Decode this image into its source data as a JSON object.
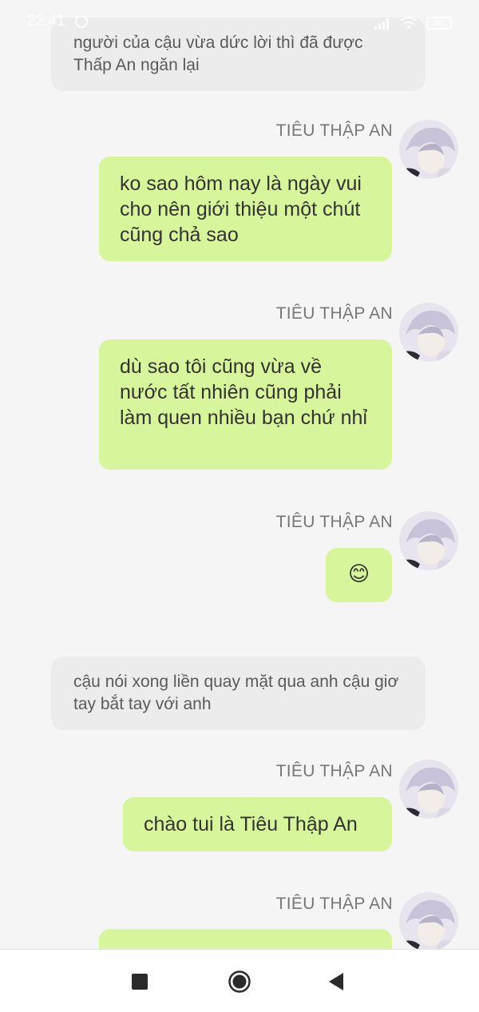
{
  "status_bar": {
    "time": "22:41",
    "battery": "80"
  },
  "messages": [
    {
      "kind": "narration",
      "text": "người của cậu vừa dức lời thì đã được Thấp An ngăn lại"
    },
    {
      "kind": "sent",
      "sender": "TIÊU THẬP AN",
      "text": "ko sao hôm nay là ngày vui cho nên giới thiệu một chút cũng chả sao"
    },
    {
      "kind": "sent",
      "sender": "TIÊU THẬP AN",
      "text": "dù sao tôi cũng vừa về nước tất nhiên cũng phải làm quen nhiều bạn chứ nhỉ"
    },
    {
      "kind": "sent",
      "sender": "TIÊU THẬP AN",
      "text": "😊"
    },
    {
      "kind": "narration",
      "text": "cậu nói xong liền quay mặt qua anh cậu giơ tay bắt tay với anh"
    },
    {
      "kind": "sent",
      "sender": "TIÊU THẬP AN",
      "text": "chào tui là Tiêu Thập An"
    },
    {
      "kind": "sent",
      "sender": "TIÊU THẬP AN",
      "text": ""
    }
  ],
  "colors": {
    "background": "#f5f5f5",
    "sent_bubble": "#d7f59b",
    "narration_bubble": "#ececec",
    "sender_name": "#777777"
  },
  "icons": {
    "nav": [
      "square-recents-icon",
      "circle-home-icon",
      "triangle-back-icon"
    ]
  }
}
